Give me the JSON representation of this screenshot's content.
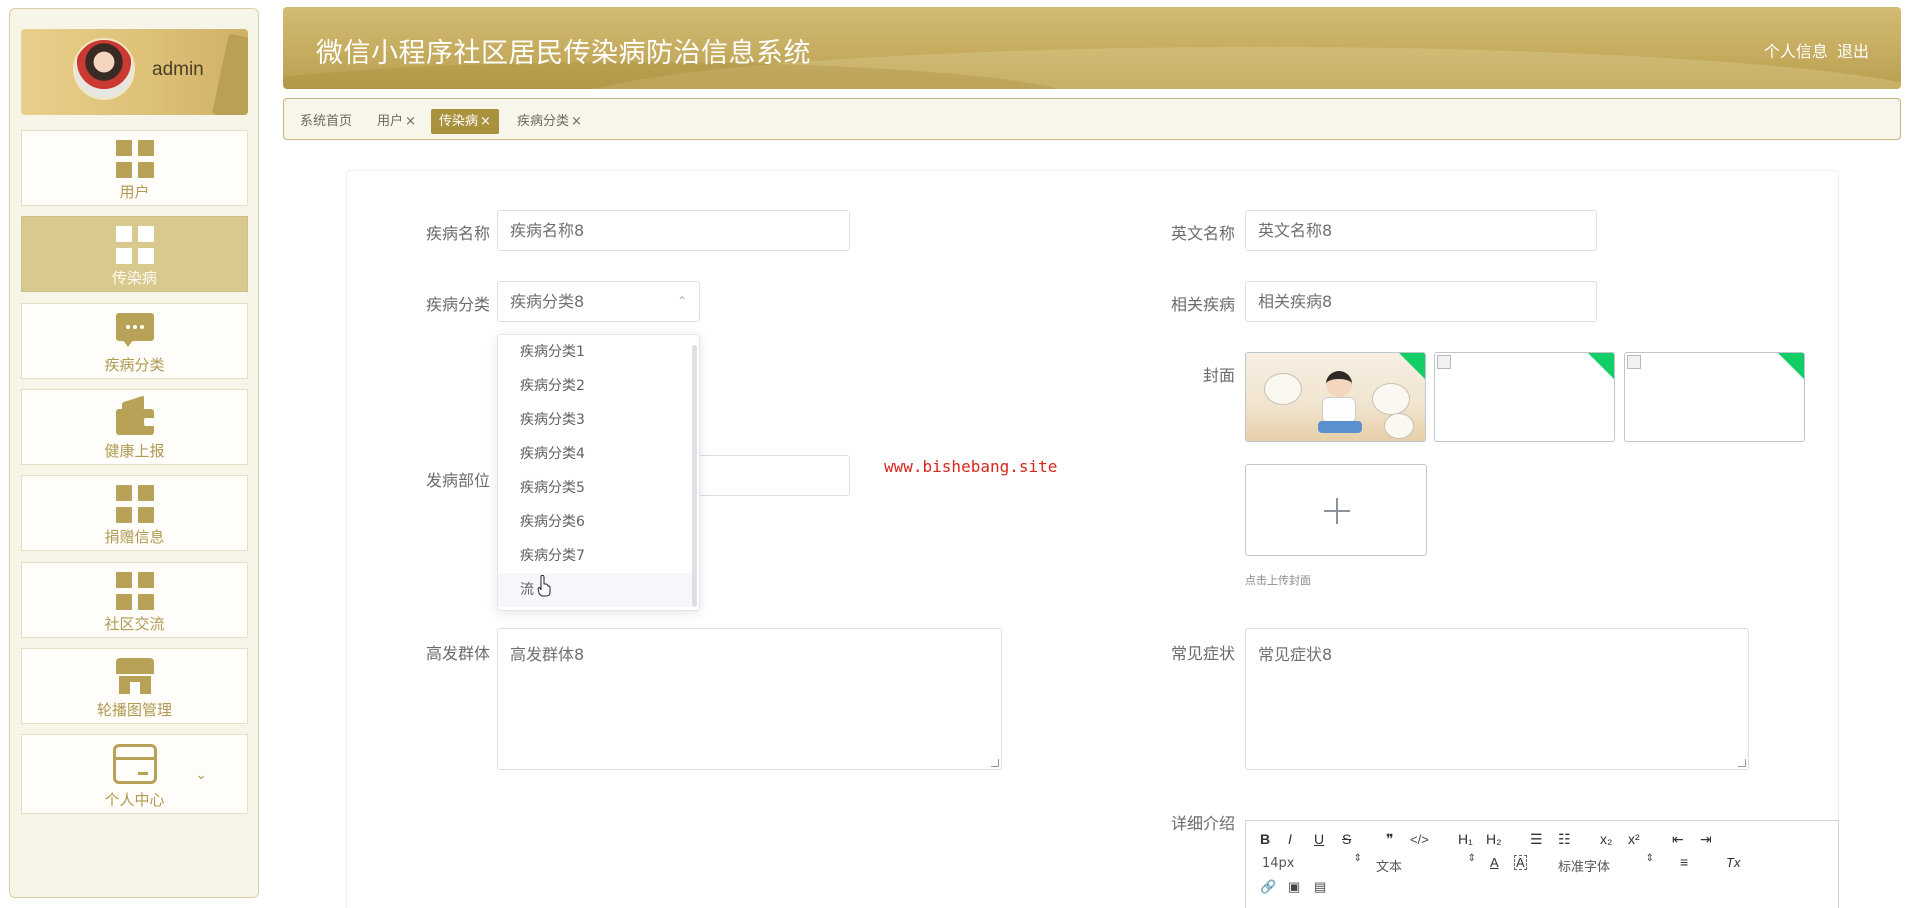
{
  "user": {
    "name": "admin"
  },
  "sidebar": {
    "items": [
      {
        "label": "用户",
        "icon": "grid-icon"
      },
      {
        "label": "传染病",
        "icon": "grid-icon"
      },
      {
        "label": "疾病分类",
        "icon": "chat-icon"
      },
      {
        "label": "健康上报",
        "icon": "wallet-icon"
      },
      {
        "label": "捐赠信息",
        "icon": "grid-icon"
      },
      {
        "label": "社区交流",
        "icon": "grid-icon"
      },
      {
        "label": "轮播图管理",
        "icon": "shop-icon"
      },
      {
        "label": "个人中心",
        "icon": "card-icon",
        "chevron": "⌄"
      }
    ]
  },
  "header": {
    "title": "微信小程序社区居民传染病防治信息系统",
    "profile_link": "个人信息",
    "logout_link": "退出"
  },
  "tabs": [
    {
      "label": "系统首页",
      "closable": false
    },
    {
      "label": "用户",
      "closable": true
    },
    {
      "label": "传染病",
      "closable": true,
      "active": true
    },
    {
      "label": "疾病分类",
      "closable": true
    }
  ],
  "tab_close": "×",
  "form": {
    "disease_name": {
      "label": "疾病名称",
      "value": "疾病名称8"
    },
    "english_name": {
      "label": "英文名称",
      "value": "英文名称8"
    },
    "category": {
      "label": "疾病分类",
      "value": "疾病分类8",
      "arrow": "⌃"
    },
    "related": {
      "label": "相关疾病",
      "value": "相关疾病8"
    },
    "cover": {
      "label": "封面",
      "upload_hint": "点击上传封面"
    },
    "site": {
      "label": "发病部位",
      "value": ""
    },
    "high_risk": {
      "label": "高发群体",
      "value": "高发群体8"
    },
    "symptoms": {
      "label": "常见症状",
      "value": "常见症状8"
    },
    "detail": {
      "label": "详细介绍"
    }
  },
  "dropdown": {
    "options": [
      "疾病分类1",
      "疾病分类2",
      "疾病分类3",
      "疾病分类4",
      "疾病分类5",
      "疾病分类6",
      "疾病分类7",
      "流"
    ],
    "hovered_index": 7
  },
  "watermark": "www.bishebang.site",
  "editor": {
    "row1": [
      "B",
      "I",
      "U",
      "S",
      "❞",
      "</>",
      "H₁",
      "H₂",
      "☰",
      "☷",
      "x₂",
      "x²",
      "⇤",
      "⇥"
    ],
    "font_size": "14px",
    "block_type": "文本",
    "font_family": "标准字体",
    "spinner": "⇕",
    "color_a": "A",
    "bg_a": "A",
    "align": "≡",
    "clear": "Tx",
    "row3": [
      "🔗",
      "▣",
      "▤"
    ]
  },
  "colors": {
    "accent": "#a9913e",
    "header_gold": "#c5ac5f",
    "nav_text": "#b29a52",
    "upload_corner": "#13ce66",
    "watermark": "#d9261c"
  }
}
